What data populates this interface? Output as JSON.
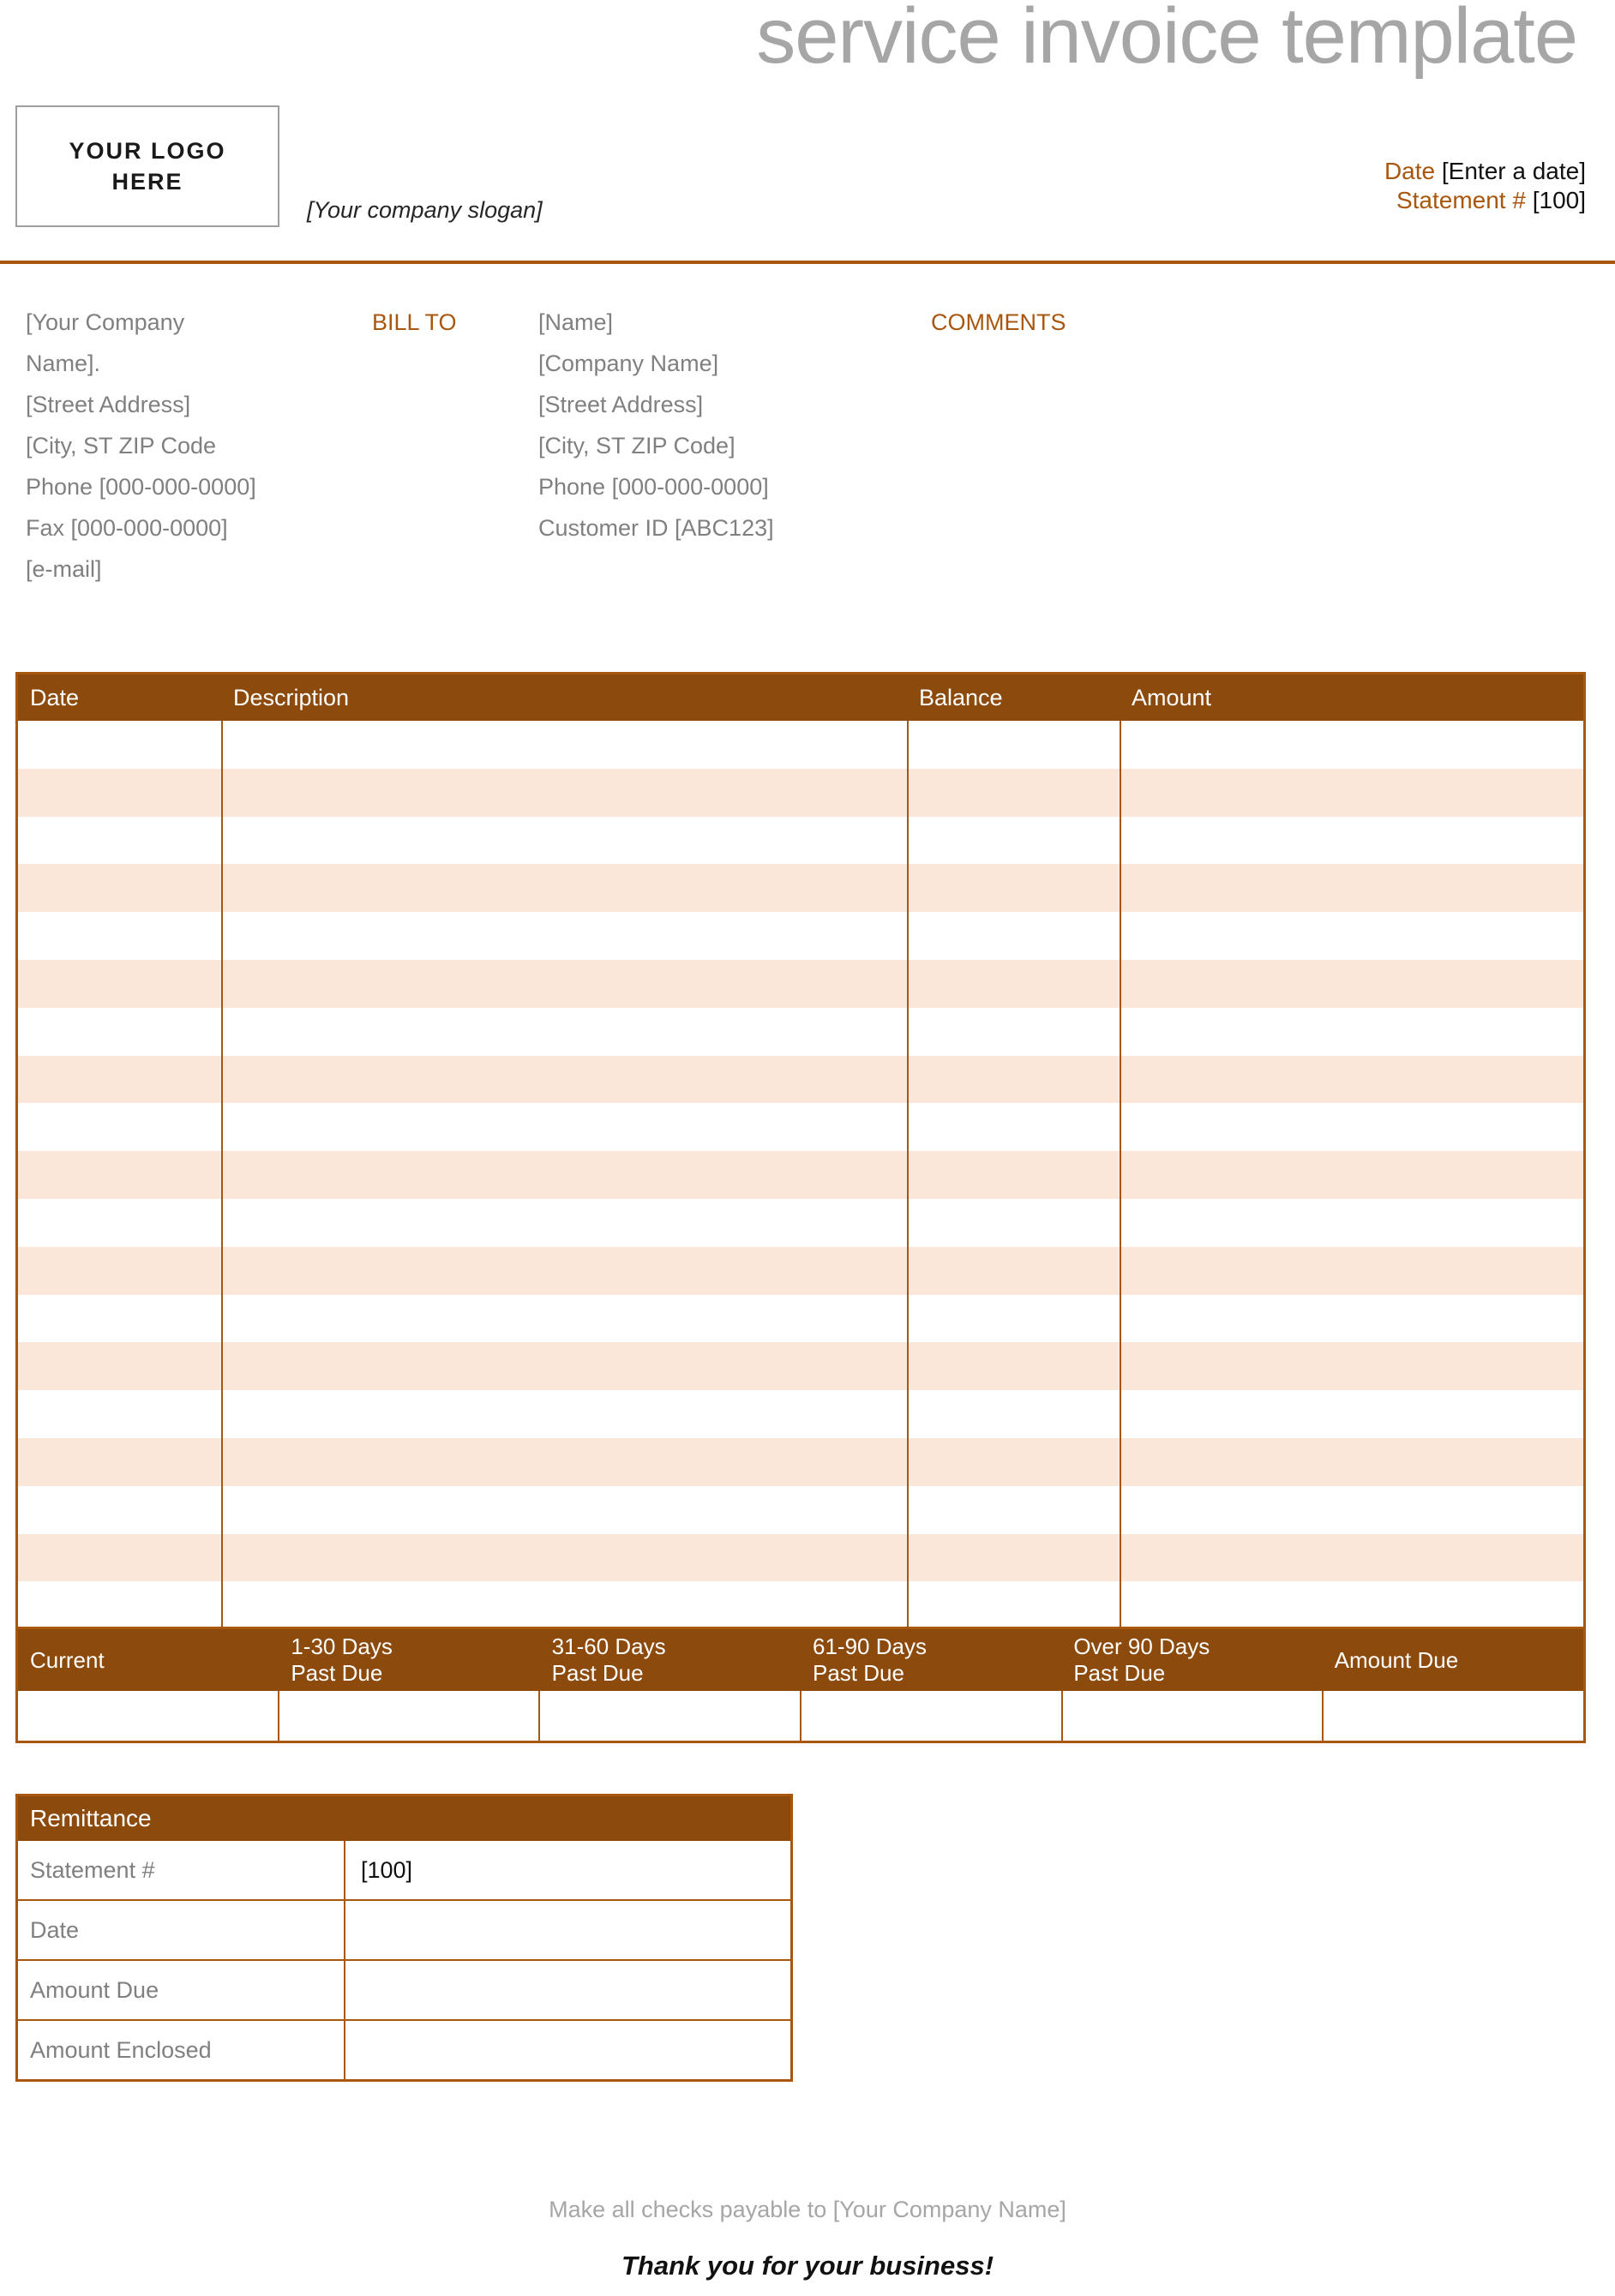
{
  "document": {
    "title": "service invoice template",
    "logo": {
      "line1": "YOUR LOGO",
      "line2": "HERE"
    },
    "slogan": "[Your company slogan]"
  },
  "meta": {
    "date_label": "Date",
    "date_value": "[Enter a date]",
    "statement_label": "Statement #",
    "statement_value": "[100]"
  },
  "addresses": {
    "from": [
      "[Your Company",
      "Name].",
      "[Street Address]",
      "[City, ST  ZIP Code",
      "Phone [000-000-0000]",
      "Fax [000-000-0000]",
      "[e-mail]"
    ],
    "bill_to_label": "BILL TO",
    "to": [
      "[Name]",
      "[Company Name]",
      "[Street Address]",
      "[City, ST  ZIP Code]",
      "Phone [000-000-0000]",
      "Customer ID [ABC123]"
    ],
    "comments_label": "COMMENTS"
  },
  "line_items": {
    "columns": [
      "Date",
      "Description",
      "Balance",
      "Amount"
    ],
    "row_count": 19,
    "rows": []
  },
  "aging": {
    "columns": [
      {
        "line1": "Current",
        "line2": ""
      },
      {
        "line1": "1-30 Days",
        "line2": "Past Due"
      },
      {
        "line1": "31-60 Days",
        "line2": "Past Due"
      },
      {
        "line1": "61-90 Days",
        "line2": "Past Due"
      },
      {
        "line1": "Over 90 Days",
        "line2": "Past Due"
      },
      {
        "line1": "Amount Due",
        "line2": ""
      }
    ],
    "values": [
      "",
      "",
      "",
      "",
      "",
      ""
    ]
  },
  "remittance": {
    "header": "Remittance",
    "rows": [
      {
        "label": "Statement #",
        "value": "[100]"
      },
      {
        "label": "Date",
        "value": ""
      },
      {
        "label": "Amount Due",
        "value": ""
      },
      {
        "label": "Amount Enclosed",
        "value": ""
      }
    ]
  },
  "footer": {
    "note": "Make all checks payable to [Your Company Name]",
    "thanks": "Thank you for your business!"
  },
  "colors": {
    "brand_brown": "#8c4a0c",
    "rule_brown": "#a9570f",
    "stripe": "#fbe7da",
    "title_gray": "#a6a6a6",
    "body_gray": "#808080"
  }
}
